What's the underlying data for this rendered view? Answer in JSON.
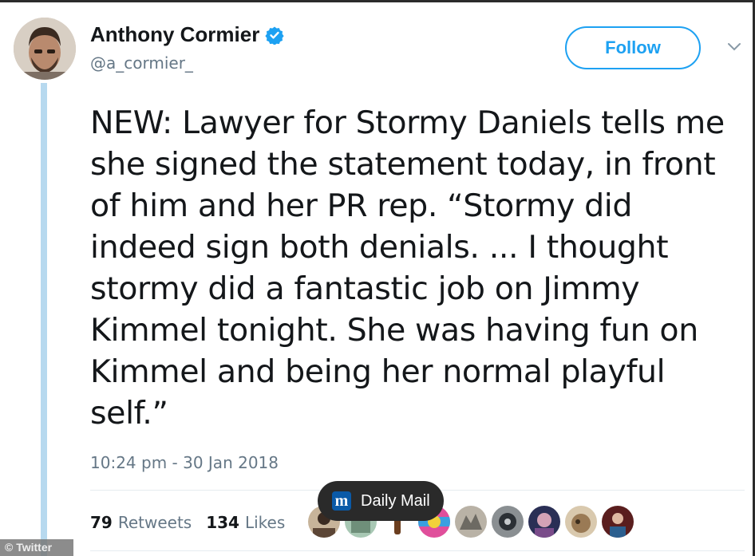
{
  "tweet": {
    "author_name": "Anthony Cormier",
    "handle": "@a_cormier_",
    "follow_label": "Follow",
    "text": "NEW: Lawyer for Stormy Daniels tells me\nshe signed the statement today, in front\nof him and her PR rep. “Stormy did\nindeed sign both denials. ... I thought\nstormy did a fantastic job on Jimmy\nKimmel tonight. She was having fun on\nKimmel and being her normal playful\nself.”",
    "timestamp": "10:24 pm - 30 Jan 2018",
    "retweets_count": "79",
    "retweets_label": "Retweets",
    "likes_count": "134",
    "likes_label": "Likes"
  },
  "overlay": {
    "badge_logo": "m",
    "badge_label": "Daily Mail",
    "watermark": "© Twitter"
  },
  "icons": {
    "verified": "verified-badge-icon",
    "menu": "chevron-down-icon"
  },
  "colors": {
    "accent": "#1da1f2",
    "secondary_text": "#657786",
    "thread_line": "#b7d9ef",
    "badge_bg": "#2a2a2a",
    "dm_logo": "#0a5aa8"
  }
}
